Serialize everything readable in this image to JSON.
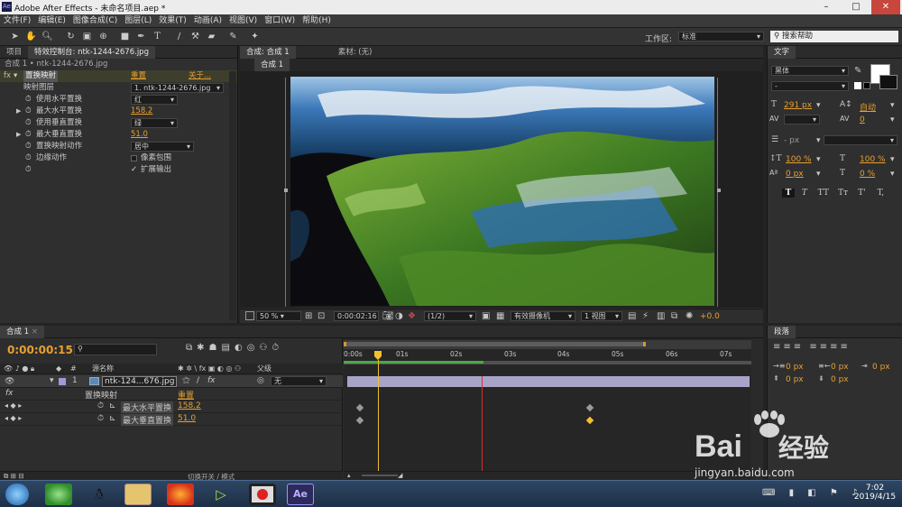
{
  "window": {
    "title": "Adobe After Effects - 未命名项目.aep *",
    "app_icon": "Ae"
  },
  "menu": [
    "文件(F)",
    "编辑(E)",
    "图像合成(C)",
    "图层(L)",
    "效果(T)",
    "动画(A)",
    "视图(V)",
    "窗口(W)",
    "帮助(H)"
  ],
  "toolbar": {
    "workspace_label": "工作区:",
    "workspace_value": "标准",
    "search_placeholder": "搜索帮助"
  },
  "left_panel": {
    "tabs": [
      "项目",
      "特效控制台: ntk-1244-2676.jpg"
    ],
    "breadcrumb": "合成 1 • ntk-1244-2676.jpg",
    "effect": {
      "fx": "fx",
      "name": "置换映射",
      "reset": "重置",
      "about": "关于..."
    },
    "props": [
      {
        "label": "映射图层",
        "value": "1. ntk-1244-2676.jpg"
      },
      {
        "label": "使用水平置换",
        "value": "红"
      },
      {
        "label": "最大水平置换",
        "value": "158.2"
      },
      {
        "label": "使用垂直置换",
        "value": "绿"
      },
      {
        "label": "最大垂直置换",
        "value": "51.0"
      },
      {
        "label": "置换映射动作",
        "value": "居中"
      },
      {
        "label": "边缘动作",
        "value": "像素包围"
      },
      {
        "label": "",
        "value": "扩展输出"
      }
    ]
  },
  "comp_panel": {
    "tabs": [
      "合成: 合成 1",
      "素材: (无)"
    ],
    "subtab": "合成 1",
    "zoom": "50 %",
    "timecode": "0:00:02:16",
    "resolution": "(1/2)",
    "camera": "有效摄像机",
    "views": "1 视图",
    "exposure": "+0.0"
  },
  "text_panel": {
    "title": "文字",
    "font": "黑体",
    "style": "-",
    "size": "291 px",
    "leading": "自动",
    "tracking": "0",
    "kerning": "",
    "stroke_size": "- px",
    "vscale": "100 %",
    "hscale": "100 %",
    "baseline": "0 px",
    "tsume": "0 %",
    "style_buttons": [
      "T",
      "T",
      "TT",
      "Tт",
      "T'",
      "T,"
    ]
  },
  "para_panel": {
    "title": "段落",
    "indent": [
      "0 px",
      "0 px",
      "0 px",
      "0 px",
      "0 px"
    ]
  },
  "timeline": {
    "tab": "合成 1",
    "timecode": "0:00:00:15",
    "search_placeholder": "",
    "col_source": "源名称",
    "col_parent": "父级",
    "layer": {
      "num": "1",
      "name": "ntk-124...676.jpg",
      "parent": "无"
    },
    "effect_row": {
      "name": "置换映射",
      "reset": "重置"
    },
    "anim_props": [
      {
        "name": "最大水平置换",
        "value": "158.2"
      },
      {
        "name": "最大垂直置换",
        "value": "51.0"
      }
    ],
    "ruler": [
      "0:00s",
      "01s",
      "02s",
      "03s",
      "04s",
      "05s",
      "06s",
      "07s"
    ],
    "footer": "切换开关 / 模式"
  },
  "taskbar": {
    "time": "7:02",
    "date": "2019/4/15"
  },
  "watermark": {
    "brand": "Bai",
    "brand2": "经验",
    "url": "jingyan.baidu.com"
  }
}
